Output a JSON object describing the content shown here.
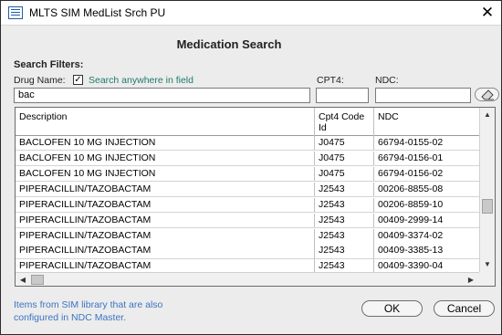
{
  "window": {
    "title": "MLTS SIM MedList Srch PU",
    "close_glyph": "✕"
  },
  "heading": "Medication Search",
  "filters": {
    "section_label": "Search Filters:",
    "drug_name_label": "Drug Name:",
    "search_anywhere_checked": true,
    "search_anywhere_glyph": "✓",
    "search_anywhere_label": "Search anywhere in field",
    "cpt4_label": "CPT4:",
    "ndc_label": "NDC:",
    "drug_name_value": "bac",
    "cpt4_value": "",
    "ndc_value": "",
    "clear_icon": "eraser-icon"
  },
  "table": {
    "columns": [
      "Description",
      "Cpt4 Code Id",
      "NDC"
    ],
    "column_header_lines": [
      [
        "Description"
      ],
      [
        "Cpt4 Code",
        "Id"
      ],
      [
        "NDC"
      ]
    ],
    "rows": [
      {
        "description": [
          "BACLOFEN 10 MG INJECTION"
        ],
        "cpt4": [
          "J0475"
        ],
        "ndc": [
          "66794-0155-02"
        ]
      },
      {
        "description": [
          "BACLOFEN 10 MG INJECTION"
        ],
        "cpt4": [
          "J0475"
        ],
        "ndc": [
          "66794-0156-01"
        ]
      },
      {
        "description": [
          "BACLOFEN 10 MG INJECTION"
        ],
        "cpt4": [
          "J0475"
        ],
        "ndc": [
          "66794-0156-02"
        ]
      },
      {
        "description": [
          "PIPERACILLIN/TAZOBACTAM"
        ],
        "cpt4": [
          "J2543"
        ],
        "ndc": [
          "00206-8855-08"
        ]
      },
      {
        "description": [
          "PIPERACILLIN/TAZOBACTAM"
        ],
        "cpt4": [
          "J2543"
        ],
        "ndc": [
          "00206-8859-10"
        ]
      },
      {
        "description": [
          "PIPERACILLIN/TAZOBACTAM"
        ],
        "cpt4": [
          "J2543"
        ],
        "ndc": [
          "00409-2999-14"
        ]
      },
      {
        "description": [
          "PIPERACILLIN/TAZOBACTAM",
          "PIPERACILLIN/TAZOBACTAM"
        ],
        "cpt4": [
          "J2543",
          "J2543"
        ],
        "ndc": [
          "00409-3374-02",
          "00409-3385-13"
        ]
      },
      {
        "description": [
          "PIPERACILLIN/TAZOBACTAM"
        ],
        "cpt4": [
          "J2543"
        ],
        "ndc": [
          "00409-3390-04"
        ]
      }
    ]
  },
  "footnote": "Items from SIM library that are also configured in NDC Master.",
  "buttons": {
    "ok": "OK",
    "cancel": "Cancel"
  }
}
